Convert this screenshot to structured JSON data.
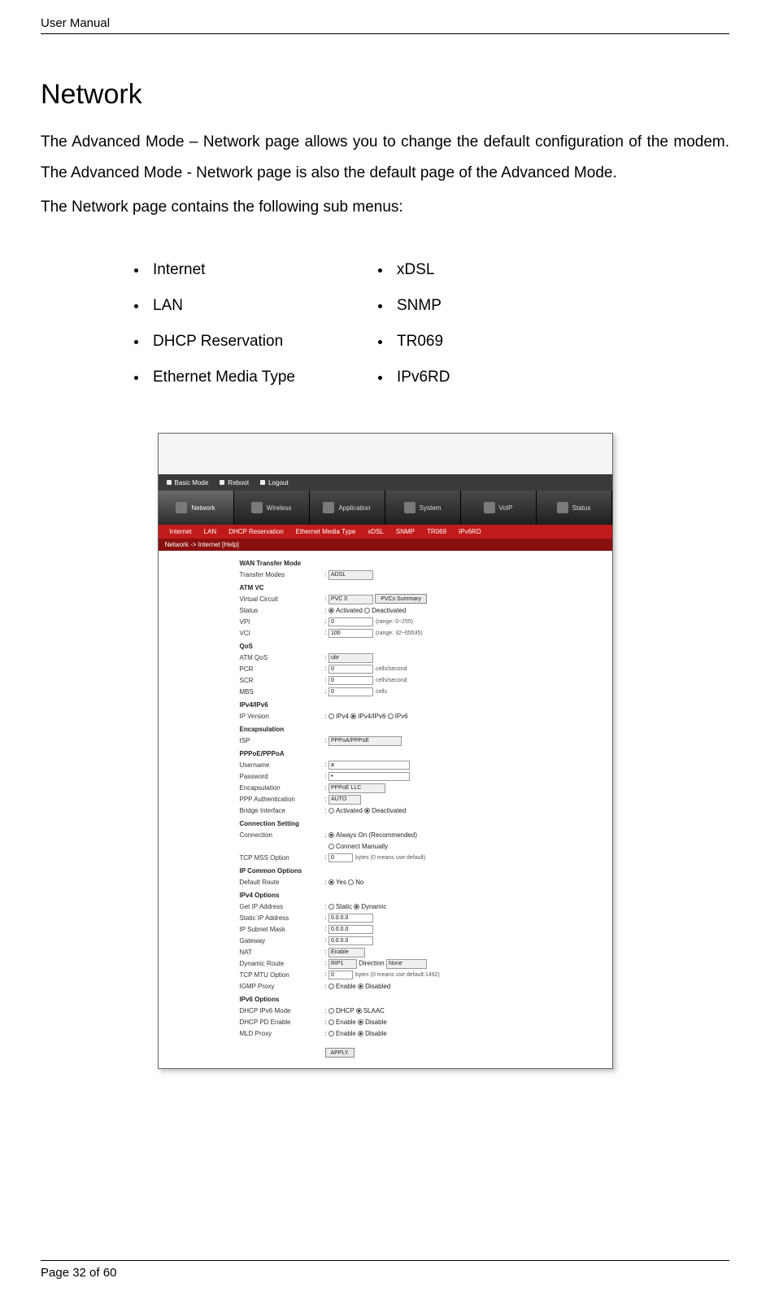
{
  "doc": {
    "header_title": "User Manual",
    "page_footer_prefix": "Page ",
    "page_footer_current": "32",
    "page_footer_of": " of 60"
  },
  "content": {
    "heading": "Network",
    "para1": "The Advanced Mode – Network page allows you to change the default configuration of the modem. The Advanced Mode - Network page is also the default page of the Advanced Mode.",
    "para2": "The Network page contains the following sub menus:",
    "menus_left": [
      "Internet",
      "LAN",
      "DHCP Reservation",
      "Ethernet Media Type"
    ],
    "menus_right": [
      "xDSL",
      "SNMP",
      "TR069",
      "IPv6RD"
    ]
  },
  "screenshot": {
    "toolbar": {
      "basic": "Basic Mode",
      "reboot": "Reboot",
      "logout": "Logout"
    },
    "maintabs": [
      "Network",
      "Wireless",
      "Application",
      "System",
      "VoIP",
      "Status"
    ],
    "subtabs": [
      "Internet",
      "LAN",
      "DHCP Reservation",
      "Ethernet Media Type",
      "xDSL",
      "SNMP",
      "TR069",
      "IPv6RD"
    ],
    "breadcrumb": "Network -> Internet [Help]",
    "sections": {
      "wan_transfer": "WAN Transfer Mode",
      "atm_vc": "ATM VC",
      "qos": "QoS",
      "ipv4ipv6": "IPv4/IPv6",
      "encap": "Encapsulation",
      "pppoe": "PPPoE/PPPoA",
      "conn": "Connection Setting",
      "ipcommon": "IP Common Options",
      "ipv4opt": "IPv4 Options",
      "ipv6opt": "IPv6 Options"
    },
    "labels": {
      "transfer_modes": "Transfer Modes",
      "vc": "Virtual Circuit",
      "pvcs_btn": "PVCs Summary",
      "status": "Status",
      "activated": "Activated",
      "deactivated": "Deactivated",
      "vpi": "VPI",
      "vpi_hint": "(range: 0~255)",
      "vci": "VCI",
      "vci_hint": "(range: 32~65535)",
      "atmqos": "ATM QoS",
      "pcr": "PCR",
      "scr": "SCR",
      "mbs": "MBS",
      "cellsec": "cells/second",
      "cells": "cells",
      "ipver": "IP Version",
      "ipv4": "IPv4",
      "ipv4v6": "IPv4/IPv6",
      "ipv6": "IPv6",
      "isp": "ISP",
      "username": "Username",
      "password": "Password",
      "encap2": "Encapsulation",
      "pppauth": "PPP Authentication",
      "bridgeif": "Bridge Interface",
      "connection": "Connection",
      "alwayson": "Always On (Recommended)",
      "connman": "Connect Manually",
      "tcpmss": "TCP MSS Option",
      "tcpmss_hint": "bytes (0 means use default)",
      "defroute": "Default Route",
      "yes": "Yes",
      "no": "No",
      "getip": "Get IP Address",
      "static": "Static",
      "dynamic": "Dynamic",
      "staticip": "Static IP Address",
      "subnet": "IP Subnet Mask",
      "gateway": "Gateway",
      "nat": "NAT",
      "dynroute": "Dynamic Route",
      "direction": "Direction",
      "tcpmtu": "TCP MTU Option",
      "tcpmtu_hint": "bytes (0 means use default:1492)",
      "igmp": "IGMP Proxy",
      "enable": "Enable",
      "disable": "Disable",
      "disabled": "Disabled",
      "dhcpipv6": "DHCP IPv6 Mode",
      "dhcp": "DHCP",
      "slaac": "SLAAC",
      "dhcppd": "DHCP PD Enable",
      "mld": "MLD Proxy",
      "apply": "APPLY"
    },
    "values": {
      "adsl": "ADSL",
      "pvc0": "PVC 0",
      "vpi": "0",
      "vci": "100",
      "ubr": "ubr",
      "pcr": "0",
      "scr": "0",
      "mbs": "0",
      "isp": "PPPoA/PPPoE",
      "user": "a",
      "pass": "•",
      "encap": "PPPoE LLC",
      "auth": "AUTO",
      "tcpmss": "0",
      "zeroip": "0.0.0.0",
      "natenable": "Enable",
      "rip1": "RIP1",
      "dirnone": "None",
      "tcpmtu": "0"
    }
  }
}
